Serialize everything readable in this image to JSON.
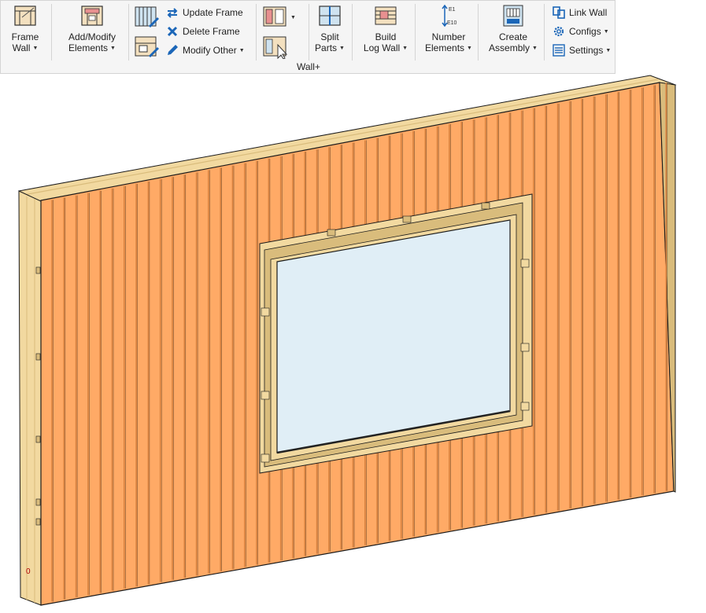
{
  "ribbon": {
    "frame_wall": {
      "line1": "Frame",
      "line2": "Wall"
    },
    "add_modify": {
      "line1": "Add/Modify",
      "line2": "Elements"
    },
    "update_frame": "Update Frame",
    "delete_frame": "Delete Frame",
    "modify_other": "Modify Other",
    "split_parts": {
      "line1": "Split",
      "line2": "Parts"
    },
    "build_log_wall": {
      "line1": "Build",
      "line2": "Log Wall"
    },
    "number_elements": {
      "line1": "Number",
      "line2": "Elements",
      "e1": "E1",
      "e10": "E10"
    },
    "create_assembly": {
      "line1": "Create",
      "line2": "Assembly"
    },
    "link_wall": "Link Wall",
    "configs": "Configs",
    "settings": "Settings",
    "group_label": "Wall+"
  },
  "viewport": {
    "origin_marker": "0",
    "colors": {
      "cladding": "#FFAA66",
      "cladding_groove": "#D9823F",
      "timber": "#F2D9A0",
      "timber_dark": "#D9BC7C",
      "glass": "#E0EEF6",
      "outline": "#1A1A1A"
    }
  }
}
